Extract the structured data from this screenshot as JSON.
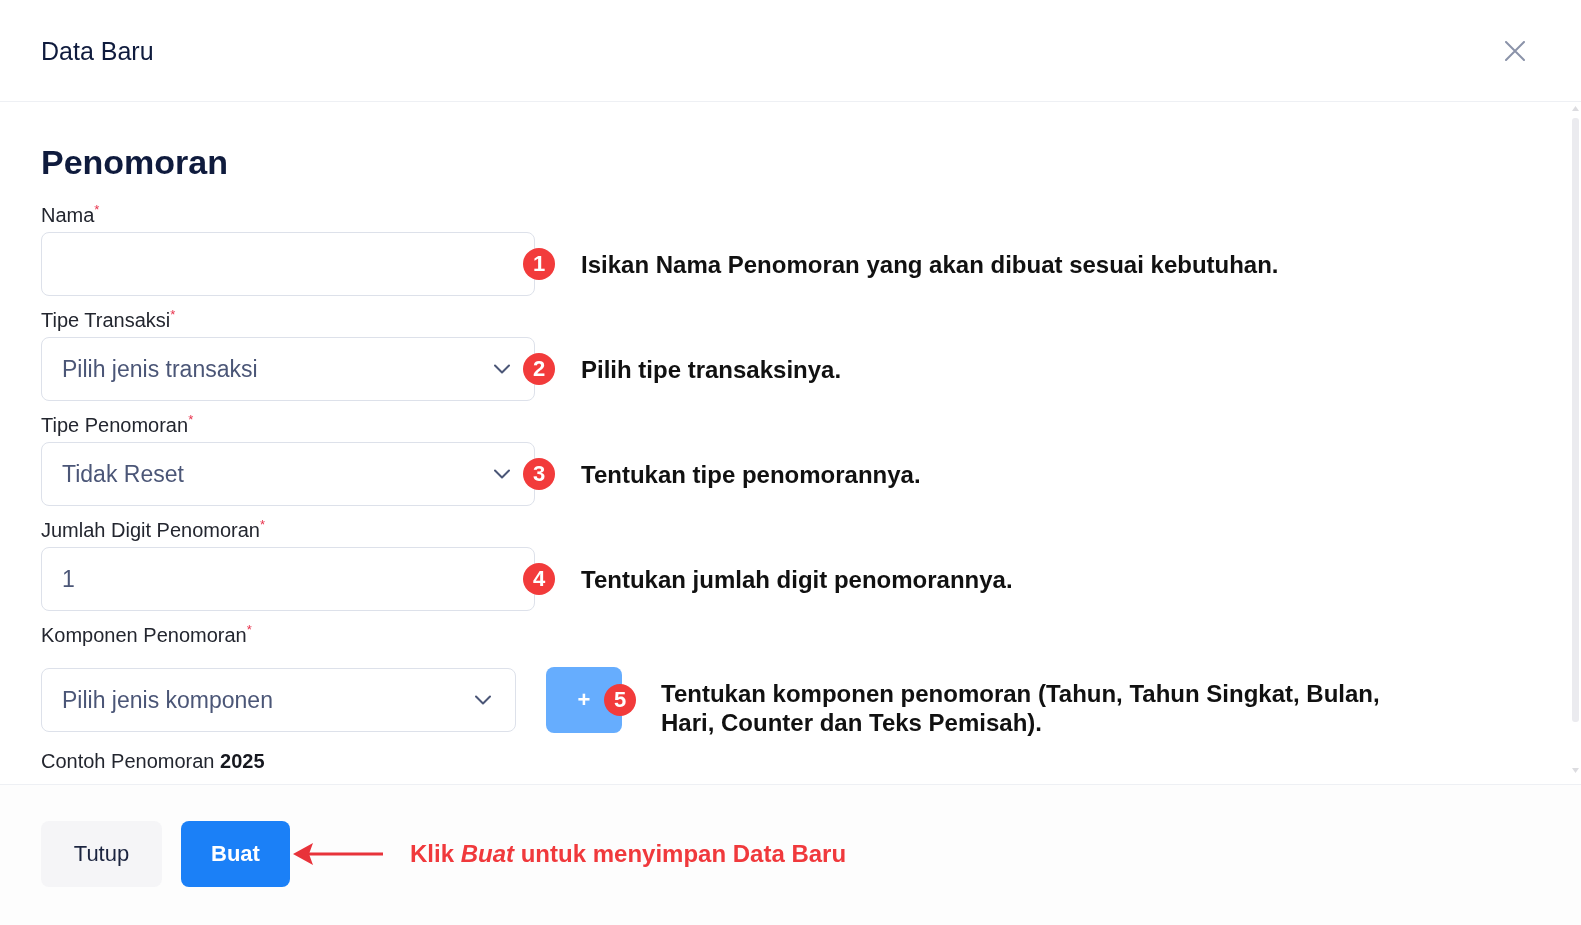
{
  "dialog": {
    "title": "Data Baru"
  },
  "form": {
    "heading": "Penomoran",
    "fields": [
      {
        "kind": "text",
        "label": "Nama$^{*}$",
        "annotation": {
          "step": "1",
          "text": "Isikan Nama Penomoran yang akan dibuat sesuai kebutuhan."
        }
      },
      {
        "kind": "select",
        "label": "Tipe Transaksi$^{*}$",
        "placeholder": "Pilih jenis transaksi",
        "annotation": {
          "step": "2",
          "text": "Pilih tipe transaksinya."
        }
      },
      {
        "kind": "select",
        "label": "Tipe Penomoran$^{*}$",
        "value": "Tidak Reset",
        "annotation": {
          "step": "3",
          "text": "Tentukan tipe penomorannya."
        }
      },
      {
        "kind": "text",
        "label": "Jumlah Digit Penomoran$^{*}$",
        "value": "1",
        "annotation": {
          "step": "4",
          "text": "Tentukan jumlah digit penomorannya."
        }
      },
      {
        "kind": "select_add",
        "label": "Komponen Penomoran$^{*}$",
        "placeholder": "Pilih jenis komponen",
        "add_button": "+",
        "annotation": {
          "step": "5",
          "text": "Tentukan komponen penomoran (Tahun, Tahun Singkat, Bulan, Hari, Counter dan Teks Pemisah)."
        }
      }
    ],
    "example": "Contoh Penomoran **2025**"
  },
  "footer": {
    "buttons": [
      {
        "kind": "secondary",
        "label": "Tutup"
      },
      {
        "kind": "primary",
        "label": "Buat"
      }
    ],
    "callout": "Klik *Buat* untuk menyimpan Data Baru"
  }
}
